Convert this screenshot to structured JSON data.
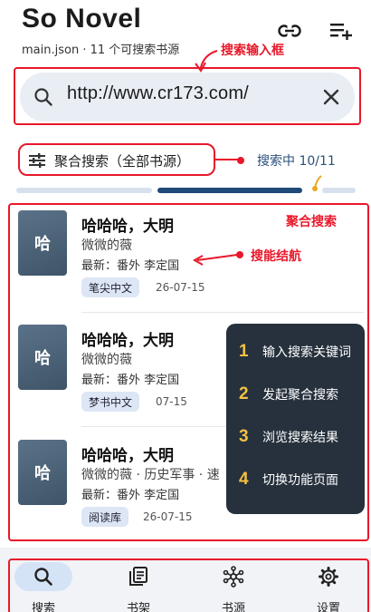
{
  "header": {
    "title": "So Novel",
    "subtitle": "main.json · 11 个可搜索书源"
  },
  "search": {
    "value": "http://www.cr173.com/"
  },
  "source_filter": {
    "label": "聚合搜索（全部书源）"
  },
  "status": {
    "text": "搜索中 10/11"
  },
  "progress": {
    "completed": 10,
    "total": 11
  },
  "annotations": {
    "search_box": "搜索输入框",
    "aggregate": "聚合搜索",
    "results": "搜能结航"
  },
  "results": [
    {
      "cover": "哈",
      "title": "哈哈哈，大明",
      "author": "微微的薇",
      "latest": "最新：番外 李定国",
      "source": "笔尖中文",
      "date": "26-07-15"
    },
    {
      "cover": "哈",
      "title": "哈哈哈，大明",
      "author": "微微的薇",
      "latest": "最新：番外 李定国",
      "source": "梦书中文",
      "date": "07-15"
    },
    {
      "cover": "哈",
      "title": "哈哈哈，大明",
      "author": "微微的薇 · 历史军事 · 速",
      "latest": "最新：番外 李定国",
      "source": "阅读库",
      "date": "26-07-15"
    }
  ],
  "guide": [
    {
      "num": "1",
      "text": "输入搜索关键词"
    },
    {
      "num": "2",
      "text": "发起聚合搜索"
    },
    {
      "num": "3",
      "text": "浏览搜索结果"
    },
    {
      "num": "4",
      "text": "切换功能页面"
    }
  ],
  "nav": [
    {
      "label": "搜索",
      "icon": "search-icon",
      "active": true
    },
    {
      "label": "书架",
      "icon": "bookshelf-icon",
      "active": false
    },
    {
      "label": "书源",
      "icon": "source-icon",
      "active": false
    },
    {
      "label": "设置",
      "icon": "gear-icon",
      "active": false
    }
  ],
  "colors": {
    "annotation": "#e8182a",
    "accent": "#2a4f7c",
    "search_bg": "#e9edf4",
    "tag_bg": "#dde6f4",
    "overlay_bg": "#26313d",
    "guide_num": "#f5c043",
    "nav_active_pill": "#d5e3f7",
    "progress_done": "#1f4a7a",
    "progress_track": "#d7e1ee"
  }
}
